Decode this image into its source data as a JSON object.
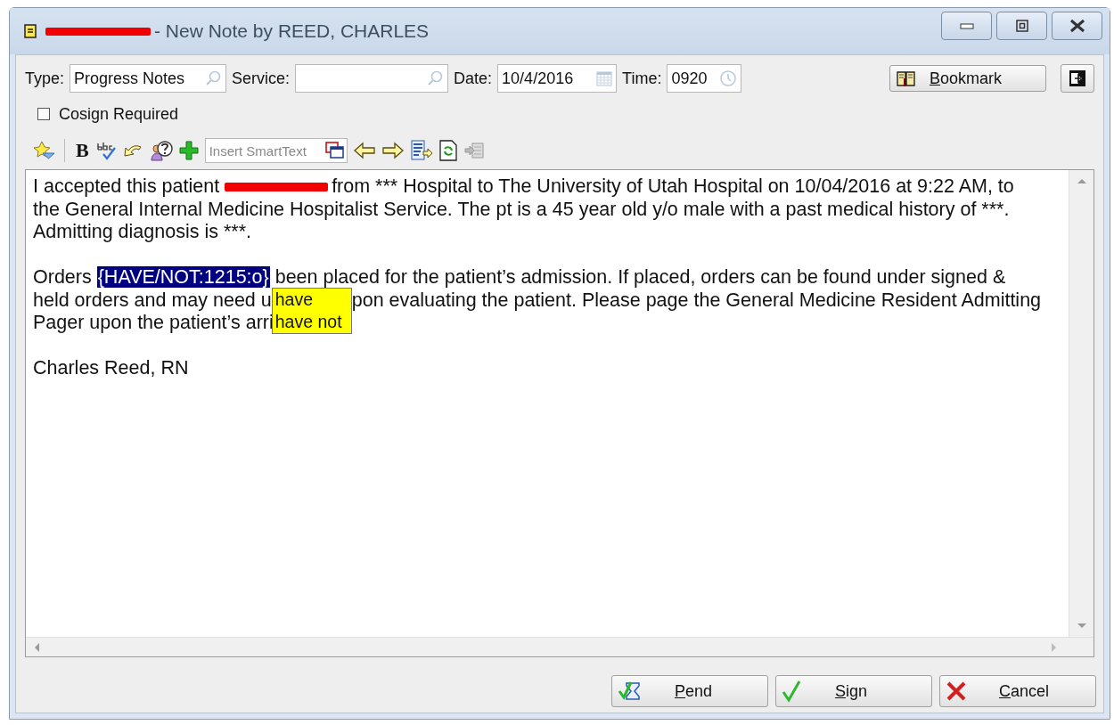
{
  "window": {
    "title": "- New Note by REED, CHARLES",
    "title_redacted": true
  },
  "fields": [
    {
      "kind": "search",
      "label": "Type:",
      "value": "Progress Notes"
    },
    {
      "kind": "search",
      "label": "Service:"
    },
    {
      "kind": "date",
      "label": "Date:",
      "value": "10/4/2016"
    },
    {
      "kind": "time",
      "label": "Time:",
      "value": "0920"
    }
  ],
  "bookmark": {
    "key": "B",
    "rest": "ookmark"
  },
  "cosign": {
    "label": "Cosign Required",
    "checked": false
  },
  "toolbar": {
    "bold": "B",
    "smarttext_placeholder": "Insert SmartText"
  },
  "note": {
    "paragraphs": [
      {
        "lines": [
          [
            {
              "kind": "text",
              "text": "I accepted this patient "
            },
            {
              "kind": "redaction"
            },
            {
              "kind": "text",
              "text": "from *** Hospital to The University of Utah Hospital on 10/04/2016 at 9:22 AM, to"
            }
          ],
          [
            {
              "kind": "text",
              "text": "the General Internal Medicine Hospitalist Service. The pt is a 45 year old y/o male with a past medical history of ***."
            }
          ],
          [
            {
              "kind": "text",
              "text": "Admitting diagnosis is ***."
            }
          ]
        ]
      },
      {
        "lines": [
          [
            {
              "kind": "text",
              "text": "Orders "
            },
            {
              "kind": "token",
              "text": "{HAVE/NOT:1215:o}",
              "selected": true
            },
            {
              "kind": "text",
              "text": " been placed for the patient’s admission. If placed, orders can be found under signed &"
            }
          ],
          [
            {
              "kind": "text",
              "text": "held orders and may need u"
            },
            {
              "kind": "popup",
              "options": [
                "have",
                "have not"
              ]
            },
            {
              "kind": "text",
              "text": "pon evaluating the patient. Please page the General Medicine Resident Admitting"
            }
          ],
          [
            {
              "kind": "text",
              "text": "Pager upon the patient’s arri"
            }
          ]
        ]
      },
      {
        "lines": [
          [
            {
              "kind": "text",
              "text": "Charles Reed, RN"
            }
          ]
        ]
      }
    ]
  },
  "buttons": [
    {
      "kind": "pend",
      "key": "P",
      "rest": "end"
    },
    {
      "kind": "sign",
      "key": "S",
      "rest": "ign"
    },
    {
      "kind": "cancel",
      "key": "C",
      "rest": "ancel"
    }
  ]
}
